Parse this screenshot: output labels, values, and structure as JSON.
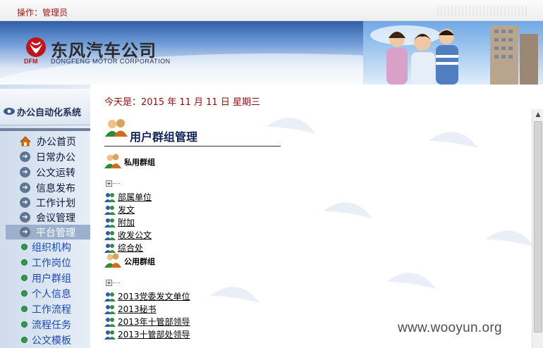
{
  "topbar": {
    "operator": "操作：管理员"
  },
  "banner": {
    "company_cn": "东风汽车公司",
    "company_en": "DONGFENG MOTOR CORPORATION",
    "brand_abbr": "DFM"
  },
  "sidebar": {
    "system_title": "办公自动化系统",
    "items": [
      {
        "label": "办公首页",
        "icon": "home-icon"
      },
      {
        "label": "日常办公",
        "icon": "arrow-circle-icon"
      },
      {
        "label": "公文运转",
        "icon": "arrow-circle-icon"
      },
      {
        "label": "信息发布",
        "icon": "arrow-circle-icon"
      },
      {
        "label": "工作计划",
        "icon": "arrow-circle-icon"
      },
      {
        "label": "会议管理",
        "icon": "arrow-circle-icon"
      },
      {
        "label": "平台管理",
        "icon": "arrow-circle-icon",
        "active": true
      }
    ],
    "subitems": [
      {
        "label": "组织机构"
      },
      {
        "label": "工作岗位"
      },
      {
        "label": "用户群组"
      },
      {
        "label": "个人信息"
      },
      {
        "label": "工作流程"
      },
      {
        "label": "流程任务"
      },
      {
        "label": "公文模板"
      }
    ]
  },
  "main": {
    "date_text": "今天是：2015 年 11 月 11 日 星期三",
    "page_title": "用户群组管理",
    "private_group": {
      "label": "私用群组",
      "items": [
        "部属单位",
        "发文",
        "附加",
        "收发公文",
        "综合处"
      ]
    },
    "public_group": {
      "label": "公用群组",
      "items": [
        "2013党委发文单位",
        "2013秘书",
        "2013年十管部领导",
        "2013十管部处领导"
      ]
    }
  },
  "watermark": "www.wooyun.org",
  "colors": {
    "accent_red": "#8b1010",
    "nav_blue": "#1c48b0",
    "title_navy": "#10245c",
    "sidebar_active": "#9bb0cc"
  }
}
